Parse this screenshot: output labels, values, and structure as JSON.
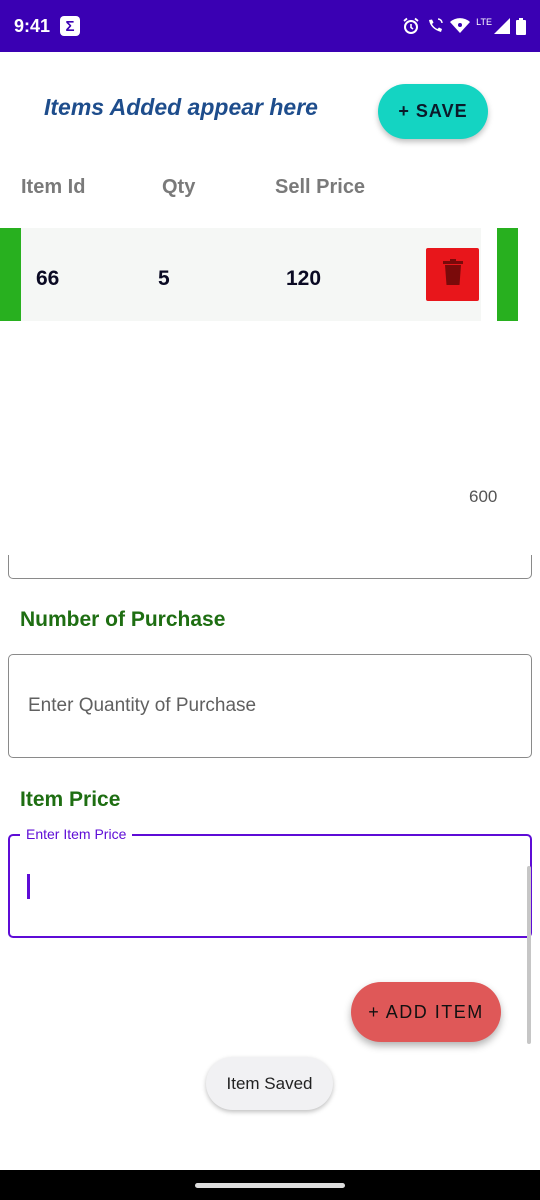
{
  "status_bar": {
    "time": "9:41",
    "badge": "Σ",
    "network": "LTE"
  },
  "header": {
    "title": "Items Added appear here",
    "save_label": "+ SAVE"
  },
  "table": {
    "columns": [
      "Item Id",
      "Qty",
      "Sell Price"
    ],
    "rows": [
      {
        "item_id": "66",
        "qty": "5",
        "sell_price": "120"
      }
    ],
    "total": "600"
  },
  "form": {
    "quantity_label": "Number of Purchase",
    "quantity_placeholder": "Enter Quantity of Purchase",
    "price_label": "Item Price",
    "price_floating_label": "Enter Item Price",
    "price_value": ""
  },
  "add_item_label": "+ ADD ITEM",
  "toast": "Item Saved",
  "colors": {
    "status_bar": "#3a00b3",
    "save_button": "#14d4c2",
    "row_accent": "#28b01f",
    "delete_button": "#e8161b",
    "section_label": "#1e6e12",
    "focus": "#5e0cd6",
    "add_item_button": "#df5858"
  },
  "icons": [
    "alarm-icon",
    "wifi-calling-icon",
    "wifi-icon",
    "signal-icon",
    "battery-icon",
    "trash-icon"
  ]
}
